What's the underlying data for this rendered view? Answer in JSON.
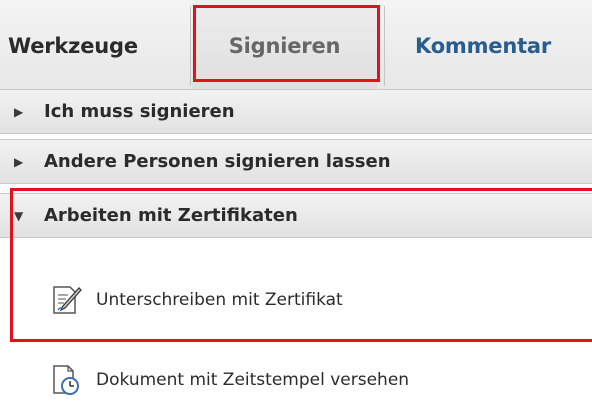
{
  "tabs": [
    {
      "label": "Werkzeuge"
    },
    {
      "label": "Signieren"
    },
    {
      "label": "Kommentar"
    }
  ],
  "sections": [
    {
      "label": "Ich muss signieren",
      "state": "collapsed"
    },
    {
      "label": "Andere Personen signieren lassen",
      "state": "collapsed"
    },
    {
      "label": "Arbeiten mit Zertifikaten",
      "state": "expanded"
    }
  ],
  "items": [
    {
      "label": "Unterschreiben mit Zertifikat",
      "icon": "sign-document-icon"
    },
    {
      "label": "Dokument mit Zeitstempel versehen",
      "icon": "timestamp-document-icon"
    }
  ],
  "colors": {
    "highlight": "#e3111b",
    "active_tab_text": "#676767",
    "link_tab_text": "#2a5d8f"
  }
}
